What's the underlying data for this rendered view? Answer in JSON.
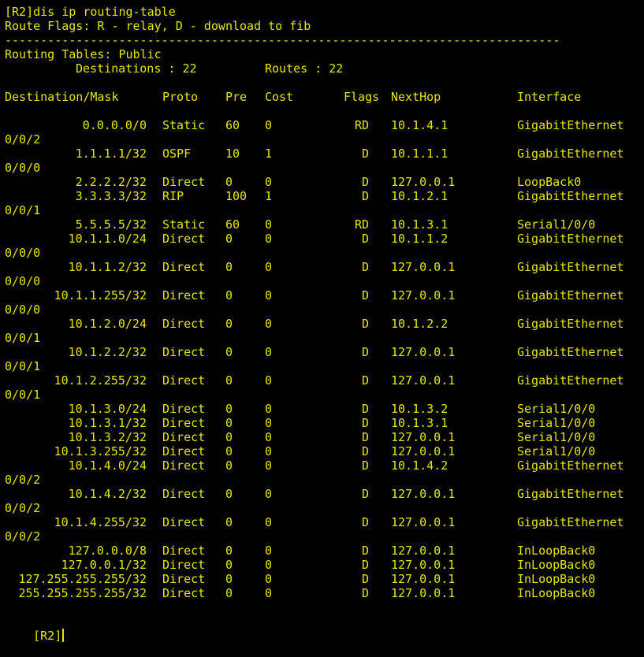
{
  "terminal": {
    "command_line": "[R2]dis ip routing-table",
    "flags_legend": "Route Flags: R - relay, D - download to fib",
    "separator": "------------------------------------------------------------------------------",
    "tables_title": "Routing Tables: Public",
    "destinations_label": "Destinations : 22",
    "routes_label": "Routes : 22",
    "headers": {
      "destination": "Destination/Mask",
      "proto": "Proto",
      "pre": "Pre",
      "cost": "Cost",
      "flags": "Flags",
      "nexthop": "NextHop",
      "interface": "Interface"
    },
    "routes": [
      {
        "dest": "0.0.0.0/0",
        "proto": "Static",
        "pre": "60",
        "cost": "0",
        "flags": "RD",
        "nexthop": "10.1.4.1",
        "iface": "GigabitEthernet",
        "iface_cont": "0/0/2"
      },
      {
        "dest": "1.1.1.1/32",
        "proto": "OSPF",
        "pre": "10",
        "cost": "1",
        "flags": "D",
        "nexthop": "10.1.1.1",
        "iface": "GigabitEthernet",
        "iface_cont": "0/0/0"
      },
      {
        "dest": "2.2.2.2/32",
        "proto": "Direct",
        "pre": "0",
        "cost": "0",
        "flags": "D",
        "nexthop": "127.0.0.1",
        "iface": "LoopBack0",
        "iface_cont": ""
      },
      {
        "dest": "3.3.3.3/32",
        "proto": "RIP",
        "pre": "100",
        "cost": "1",
        "flags": "D",
        "nexthop": "10.1.2.1",
        "iface": "GigabitEthernet",
        "iface_cont": "0/0/1"
      },
      {
        "dest": "5.5.5.5/32",
        "proto": "Static",
        "pre": "60",
        "cost": "0",
        "flags": "RD",
        "nexthop": "10.1.3.1",
        "iface": "Serial1/0/0",
        "iface_cont": ""
      },
      {
        "dest": "10.1.1.0/24",
        "proto": "Direct",
        "pre": "0",
        "cost": "0",
        "flags": "D",
        "nexthop": "10.1.1.2",
        "iface": "GigabitEthernet",
        "iface_cont": "0/0/0"
      },
      {
        "dest": "10.1.1.2/32",
        "proto": "Direct",
        "pre": "0",
        "cost": "0",
        "flags": "D",
        "nexthop": "127.0.0.1",
        "iface": "GigabitEthernet",
        "iface_cont": "0/0/0"
      },
      {
        "dest": "10.1.1.255/32",
        "proto": "Direct",
        "pre": "0",
        "cost": "0",
        "flags": "D",
        "nexthop": "127.0.0.1",
        "iface": "GigabitEthernet",
        "iface_cont": "0/0/0"
      },
      {
        "dest": "10.1.2.0/24",
        "proto": "Direct",
        "pre": "0",
        "cost": "0",
        "flags": "D",
        "nexthop": "10.1.2.2",
        "iface": "GigabitEthernet",
        "iface_cont": "0/0/1"
      },
      {
        "dest": "10.1.2.2/32",
        "proto": "Direct",
        "pre": "0",
        "cost": "0",
        "flags": "D",
        "nexthop": "127.0.0.1",
        "iface": "GigabitEthernet",
        "iface_cont": "0/0/1"
      },
      {
        "dest": "10.1.2.255/32",
        "proto": "Direct",
        "pre": "0",
        "cost": "0",
        "flags": "D",
        "nexthop": "127.0.0.1",
        "iface": "GigabitEthernet",
        "iface_cont": "0/0/1"
      },
      {
        "dest": "10.1.3.0/24",
        "proto": "Direct",
        "pre": "0",
        "cost": "0",
        "flags": "D",
        "nexthop": "10.1.3.2",
        "iface": "Serial1/0/0",
        "iface_cont": ""
      },
      {
        "dest": "10.1.3.1/32",
        "proto": "Direct",
        "pre": "0",
        "cost": "0",
        "flags": "D",
        "nexthop": "10.1.3.1",
        "iface": "Serial1/0/0",
        "iface_cont": ""
      },
      {
        "dest": "10.1.3.2/32",
        "proto": "Direct",
        "pre": "0",
        "cost": "0",
        "flags": "D",
        "nexthop": "127.0.0.1",
        "iface": "Serial1/0/0",
        "iface_cont": ""
      },
      {
        "dest": "10.1.3.255/32",
        "proto": "Direct",
        "pre": "0",
        "cost": "0",
        "flags": "D",
        "nexthop": "127.0.0.1",
        "iface": "Serial1/0/0",
        "iface_cont": ""
      },
      {
        "dest": "10.1.4.0/24",
        "proto": "Direct",
        "pre": "0",
        "cost": "0",
        "flags": "D",
        "nexthop": "10.1.4.2",
        "iface": "GigabitEthernet",
        "iface_cont": "0/0/2"
      },
      {
        "dest": "10.1.4.2/32",
        "proto": "Direct",
        "pre": "0",
        "cost": "0",
        "flags": "D",
        "nexthop": "127.0.0.1",
        "iface": "GigabitEthernet",
        "iface_cont": "0/0/2"
      },
      {
        "dest": "10.1.4.255/32",
        "proto": "Direct",
        "pre": "0",
        "cost": "0",
        "flags": "D",
        "nexthop": "127.0.0.1",
        "iface": "GigabitEthernet",
        "iface_cont": "0/0/2"
      },
      {
        "dest": "127.0.0.0/8",
        "proto": "Direct",
        "pre": "0",
        "cost": "0",
        "flags": "D",
        "nexthop": "127.0.0.1",
        "iface": "InLoopBack0",
        "iface_cont": ""
      },
      {
        "dest": "127.0.0.1/32",
        "proto": "Direct",
        "pre": "0",
        "cost": "0",
        "flags": "D",
        "nexthop": "127.0.0.1",
        "iface": "InLoopBack0",
        "iface_cont": ""
      },
      {
        "dest": "127.255.255.255/32",
        "proto": "Direct",
        "pre": "0",
        "cost": "0",
        "flags": "D",
        "nexthop": "127.0.0.1",
        "iface": "InLoopBack0",
        "iface_cont": ""
      },
      {
        "dest": "255.255.255.255/32",
        "proto": "Direct",
        "pre": "0",
        "cost": "0",
        "flags": "D",
        "nexthop": "127.0.0.1",
        "iface": "InLoopBack0",
        "iface_cont": ""
      }
    ],
    "prompt": "[R2]",
    "colors": {
      "background": "#000000",
      "foreground": "#e6e600"
    }
  }
}
